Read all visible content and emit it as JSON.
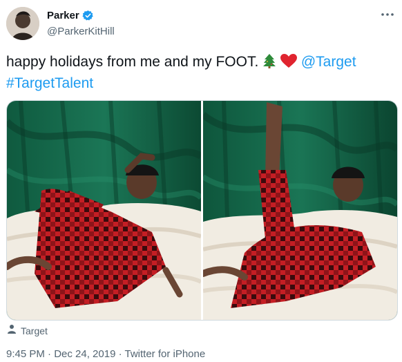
{
  "user": {
    "display_name": "Parker",
    "handle": "@ParkerKitHill",
    "verified": true
  },
  "header": {
    "more_icon": "ellipsis-icon"
  },
  "tweet": {
    "text_plain": "happy holidays from me and my FOOT.",
    "emojis": [
      "christmas-tree-emoji",
      "red-heart-emoji"
    ],
    "mention": "@Target",
    "hashtag": "#TargetTalent"
  },
  "media": {
    "count": 2,
    "photos": [
      {
        "name": "photo-reclining-pose"
      },
      {
        "name": "photo-leg-raised-pose"
      }
    ]
  },
  "tagged": {
    "label": "Target",
    "icon": "person-icon"
  },
  "meta": {
    "text": "9:45 PM · Dec 24, 2019 · Twitter for iPhone"
  },
  "colors": {
    "link": "#1d9bf0",
    "secondary_text": "#536471",
    "verified_badge": "#1d9bf0"
  }
}
